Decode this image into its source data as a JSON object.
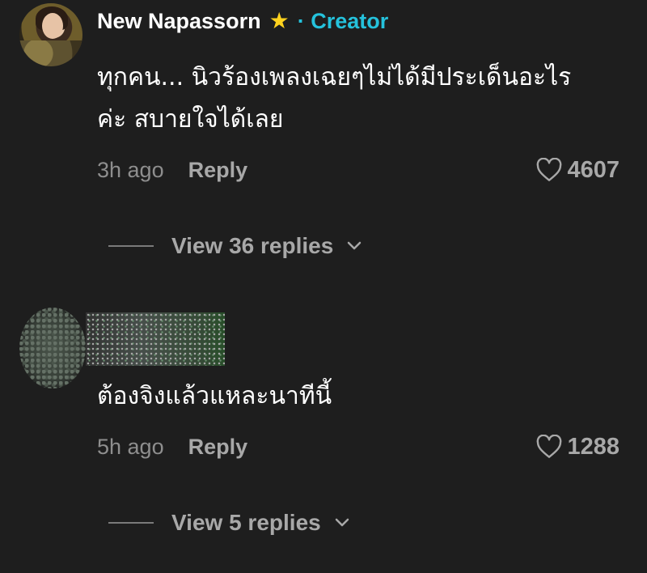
{
  "comments": [
    {
      "author": "New Napassorn",
      "badge_icon": "star-icon",
      "badge_separator": "·",
      "badge_label": "Creator",
      "text_line1": "ทุกคน... นิวร้องเพลงเฉยๆไม่ได้มีประเด็นอะไร",
      "text_line2": "ค่ะ สบายใจได้เลย",
      "time": "3h ago",
      "reply_label": "Reply",
      "likes": "4607",
      "view_replies": "View 36 replies"
    },
    {
      "author_obscured": true,
      "text_line1": "ต้องจิงแล้วแหละนาทีนี้",
      "time": "5h ago",
      "reply_label": "Reply",
      "likes": "1288",
      "view_replies": "View 5 replies"
    }
  ],
  "colors": {
    "background": "#1e1e1e",
    "creator_accent": "#25c2dc",
    "star": "#ffd21e",
    "muted_text": "#a8a8a8"
  }
}
